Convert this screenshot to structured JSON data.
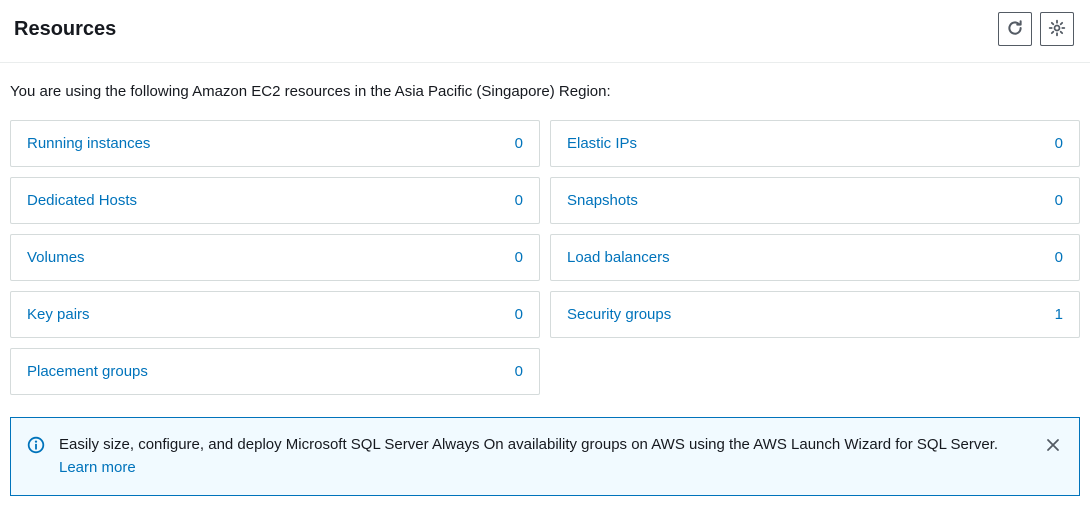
{
  "header": {
    "title": "Resources"
  },
  "intro": "You are using the following Amazon EC2 resources in the Asia Pacific (Singapore) Region:",
  "resources": {
    "left": [
      {
        "label": "Running instances",
        "count": "0"
      },
      {
        "label": "Dedicated Hosts",
        "count": "0"
      },
      {
        "label": "Volumes",
        "count": "0"
      },
      {
        "label": "Key pairs",
        "count": "0"
      },
      {
        "label": "Placement groups",
        "count": "0"
      }
    ],
    "right": [
      {
        "label": "Elastic IPs",
        "count": "0"
      },
      {
        "label": "Snapshots",
        "count": "0"
      },
      {
        "label": "Load balancers",
        "count": "0"
      },
      {
        "label": "Security groups",
        "count": "1"
      }
    ]
  },
  "banner": {
    "text": "Easily size, configure, and deploy Microsoft SQL Server Always On availability groups on AWS using the AWS Launch Wizard for SQL Server. ",
    "link_text": "Learn more"
  }
}
